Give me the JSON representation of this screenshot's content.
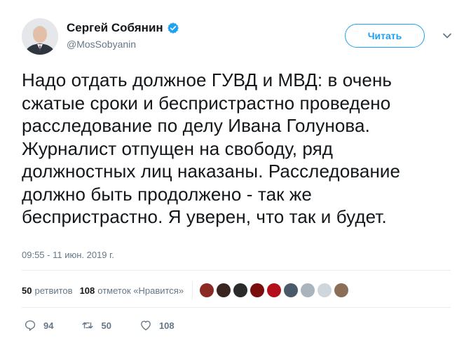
{
  "header": {
    "name": "Сергей Собянин",
    "handle": "@MosSobyanin",
    "follow_label": "Читать",
    "verified_icon": "verified-badge-icon",
    "menu_icon": "chevron-down-icon"
  },
  "tweet": {
    "lines": [
      "Надо отдать должное ГУВД и МВД: в очень",
      "сжатые сроки и беспристрастно проведено",
      "расследование по делу Ивана Голунова.",
      "Журналист отпущен на свободу, ряд",
      "должностных лиц наказаны. Расследование",
      "должно быть продолжено - так же",
      "беспристрастно. Я уверен, что так и будет."
    ],
    "timestamp": "09:55 - 11 июн. 2019 г."
  },
  "stats": {
    "retweets_count": "50",
    "retweets_label": "ретвитов",
    "likes_count": "108",
    "likes_label": "отметок «Нравится»",
    "liker_colors": [
      "#8a2a22",
      "#3a2520",
      "#2b2b2b",
      "#7a0d0d",
      "#b3101b",
      "#4a5a6a",
      "#a9b4bd",
      "#cfd6dc",
      "#8a6e58"
    ]
  },
  "actions": {
    "reply_count": "94",
    "retweet_count": "50",
    "like_count": "108"
  },
  "colors": {
    "accent": "#1da1f2",
    "secondary_text": "#657786",
    "divider": "#e6ecf0"
  }
}
